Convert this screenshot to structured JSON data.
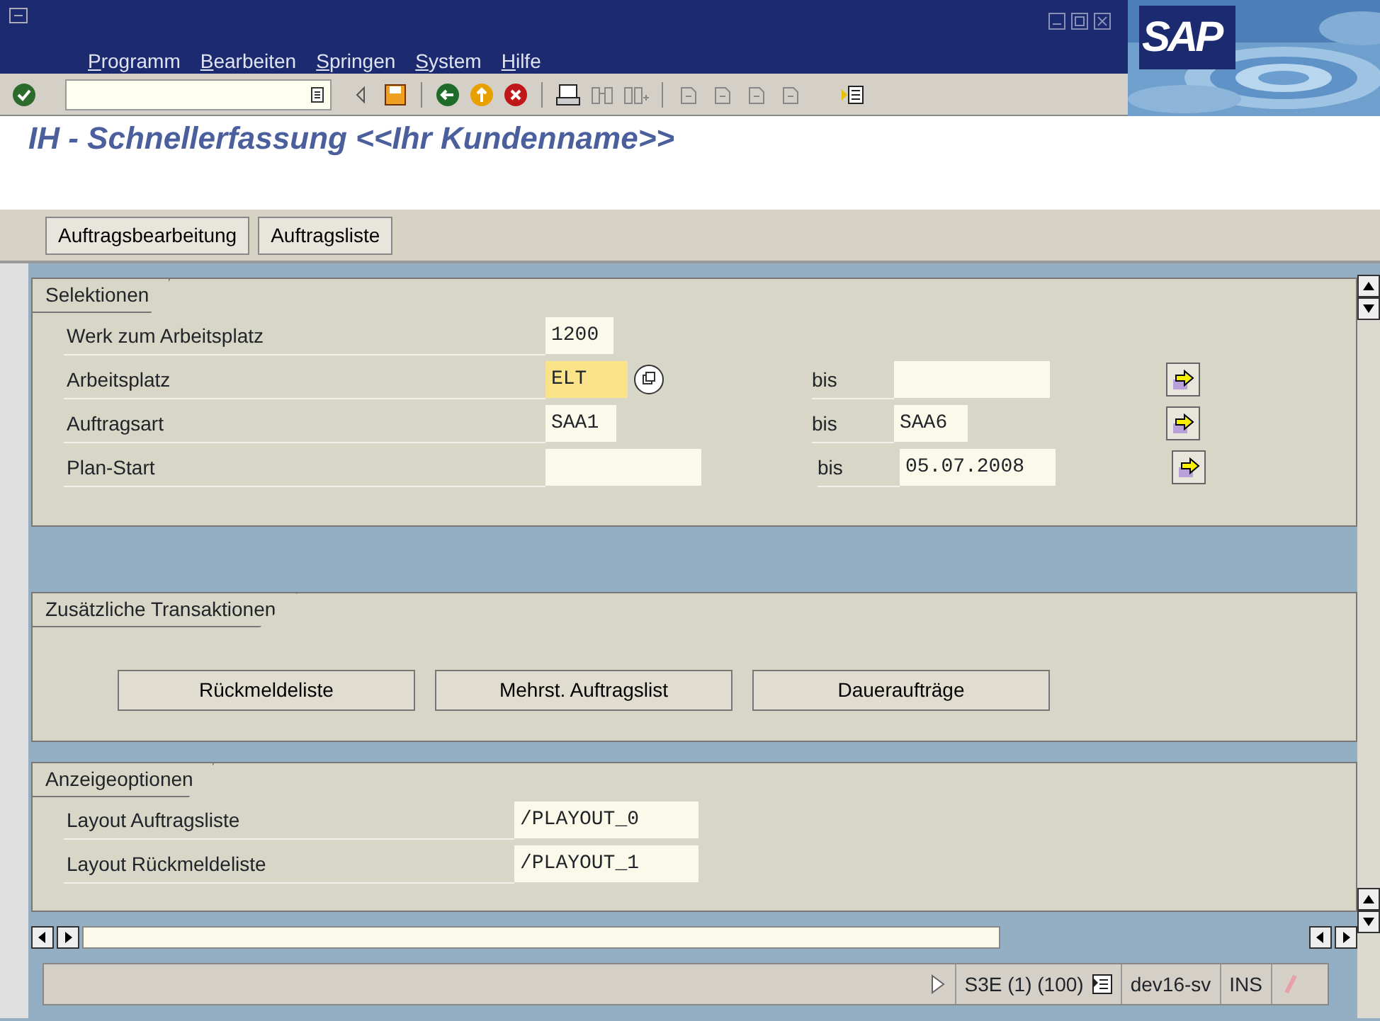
{
  "window": {
    "menu": [
      {
        "label": "Programm"
      },
      {
        "label": "Bearbeiten"
      },
      {
        "label": "Springen"
      },
      {
        "label": "System"
      },
      {
        "label": "Hilfe"
      }
    ],
    "logo": "SAP"
  },
  "title": "IH - Schnellerfassung <<Ihr Kundenname>>",
  "app_buttons": [
    "Auftragsbearbeitung",
    "Auftragsliste"
  ],
  "selections": {
    "title": "Selektionen",
    "rows": [
      {
        "kind": "single",
        "label": "Werk zum Arbeitsplatz",
        "from": "1200"
      },
      {
        "kind": "range",
        "label": "Arbeitsplatz",
        "from": "ELT",
        "focused": true,
        "help": true,
        "bis": "bis"
      },
      {
        "kind": "range",
        "label": "Auftragsart",
        "from": "SAA1",
        "focused": false,
        "bis": "bis",
        "to": "SAA6"
      },
      {
        "kind": "range",
        "label": "Plan-Start",
        "focused": false,
        "bis": "bis",
        "to": "05.07.2008"
      }
    ]
  },
  "transactions": {
    "title": "Zusätzliche Transaktionen",
    "buttons": [
      "Rückmeldeliste",
      "Mehrst. Auftragslist",
      "Daueraufträge"
    ]
  },
  "display_options": {
    "title": "Anzeigeoptionen",
    "rows": [
      {
        "label": "Layout Auftragsliste",
        "value": "/PLAYOUT_0"
      },
      {
        "label": "Layout Rückmeldeliste",
        "value": "/PLAYOUT_1"
      }
    ]
  },
  "status_bar": {
    "system": "S3E (1) (100)",
    "server": "dev16-sv",
    "mode": "INS"
  }
}
